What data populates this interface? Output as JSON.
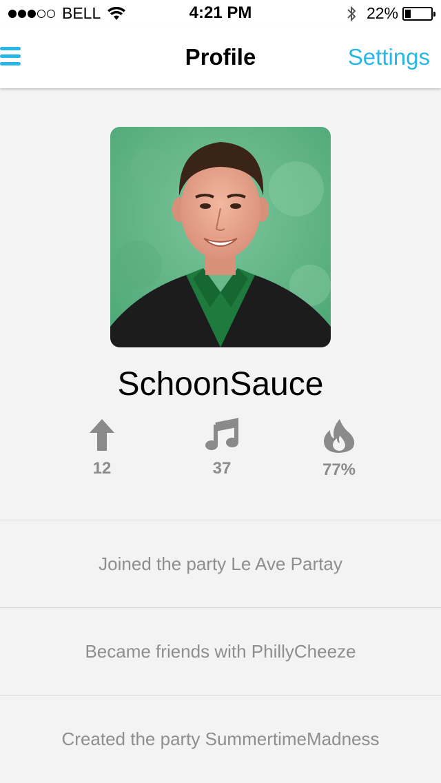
{
  "status_bar": {
    "carrier": "BELL",
    "signal": {
      "filled": 3,
      "total": 5
    },
    "time": "4:21 PM",
    "battery_percent_label": "22%",
    "battery_level": 0.22
  },
  "nav": {
    "title": "Profile",
    "settings_label": "Settings",
    "menu_icon": "hamburger-menu-icon"
  },
  "profile": {
    "username": "SchoonSauce",
    "stats": [
      {
        "icon": "arrow-up-icon",
        "value": "12"
      },
      {
        "icon": "music-note-icon",
        "value": "37"
      },
      {
        "icon": "flame-icon",
        "value": "77%"
      }
    ]
  },
  "activity": [
    {
      "text": "Joined the party Le Ave Partay"
    },
    {
      "text": "Became friends with PhillyCheeze"
    },
    {
      "text": "Created the party SummertimeMadness"
    }
  ],
  "colors": {
    "accent": "#29b6e8",
    "background": "#f3f3f3",
    "muted_text": "#8e8e8e"
  }
}
